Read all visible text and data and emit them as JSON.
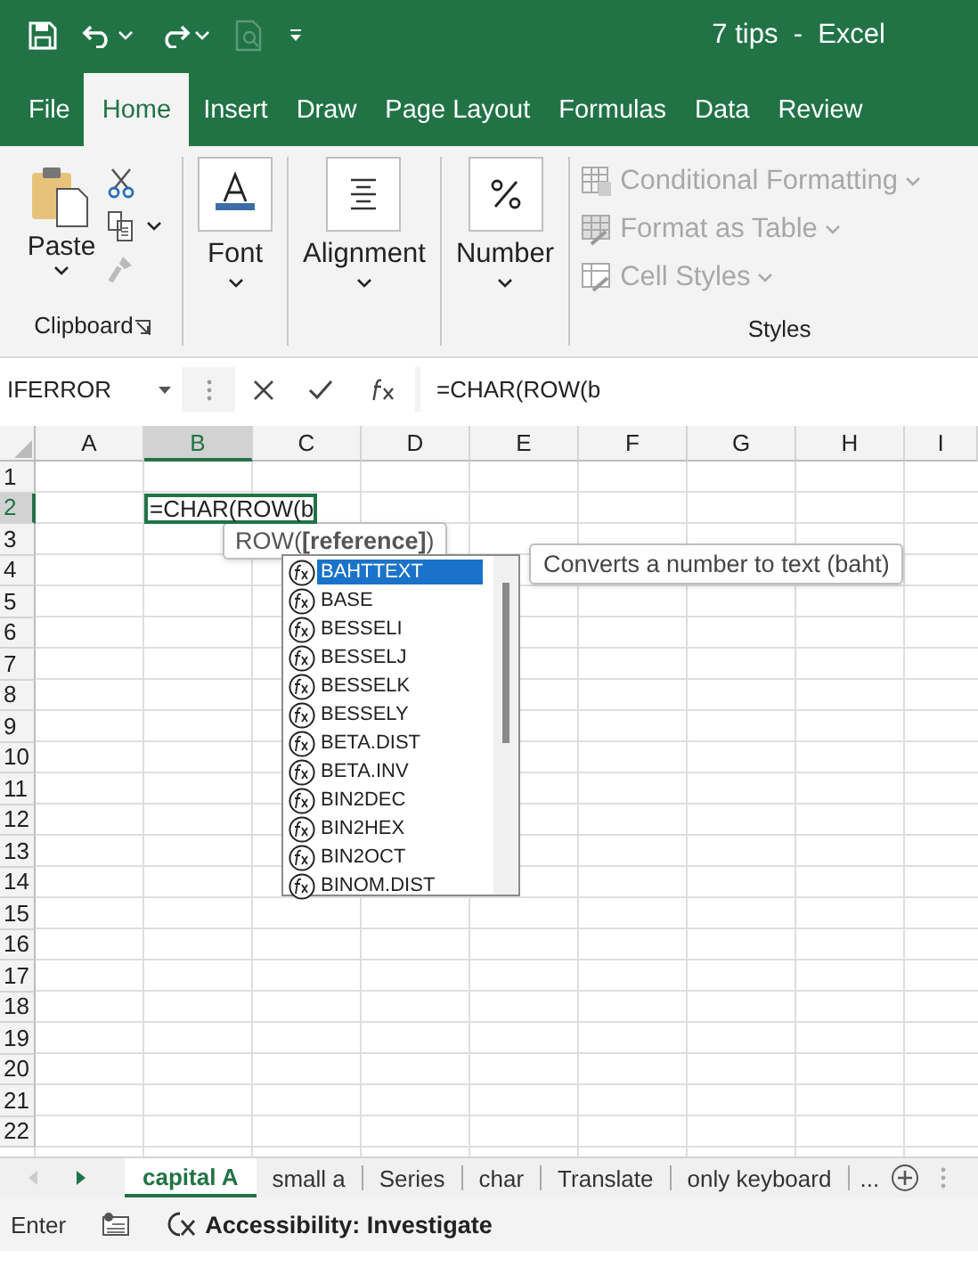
{
  "window": {
    "title": "7 tips  -  Excel"
  },
  "ribbon_tabs": [
    {
      "label": "File",
      "selected": false
    },
    {
      "label": "Home",
      "selected": true
    },
    {
      "label": "Insert",
      "selected": false
    },
    {
      "label": "Draw",
      "selected": false
    },
    {
      "label": "Page Layout",
      "selected": false
    },
    {
      "label": "Formulas",
      "selected": false
    },
    {
      "label": "Data",
      "selected": false
    },
    {
      "label": "Review",
      "selected": false
    }
  ],
  "clipboard": {
    "label": "Clipboard",
    "paste": "Paste"
  },
  "collapsed_groups": [
    {
      "kind": "font",
      "label": "Font"
    },
    {
      "kind": "alignment",
      "label": "Alignment"
    },
    {
      "kind": "number",
      "label": "Number"
    }
  ],
  "styles": {
    "label": "Styles",
    "items": [
      {
        "kind": "conditional",
        "label": "Conditional Formatting",
        "disabled": true
      },
      {
        "kind": "table",
        "label": "Format as Table",
        "disabled": true
      },
      {
        "kind": "cellstyles",
        "label": "Cell Styles",
        "disabled": true
      }
    ]
  },
  "formula_bar": {
    "name_box": "IFERROR",
    "formula": "=CHAR(ROW(b"
  },
  "sheet": {
    "columns": [
      {
        "label": "A",
        "selected": false
      },
      {
        "label": "B",
        "selected": true
      },
      {
        "label": "C",
        "selected": false
      },
      {
        "label": "D",
        "selected": false
      },
      {
        "label": "E",
        "selected": false
      },
      {
        "label": "F",
        "selected": false
      },
      {
        "label": "G",
        "selected": false
      },
      {
        "label": "H",
        "selected": false
      },
      {
        "label": "I",
        "selected": false
      }
    ],
    "rows": [
      {
        "label": "1",
        "selected": false
      },
      {
        "label": "2",
        "selected": true
      },
      {
        "label": "3",
        "selected": false
      },
      {
        "label": "4",
        "selected": false
      },
      {
        "label": "5",
        "selected": false
      },
      {
        "label": "6",
        "selected": false
      },
      {
        "label": "7",
        "selected": false
      },
      {
        "label": "8",
        "selected": false
      },
      {
        "label": "9",
        "selected": false
      },
      {
        "label": "10",
        "selected": false
      },
      {
        "label": "11",
        "selected": false
      },
      {
        "label": "12",
        "selected": false
      },
      {
        "label": "13",
        "selected": false
      },
      {
        "label": "14",
        "selected": false
      },
      {
        "label": "15",
        "selected": false
      },
      {
        "label": "16",
        "selected": false
      },
      {
        "label": "17",
        "selected": false
      },
      {
        "label": "18",
        "selected": false
      },
      {
        "label": "19",
        "selected": false
      },
      {
        "label": "20",
        "selected": false
      },
      {
        "label": "21",
        "selected": false
      },
      {
        "label": "22",
        "selected": false
      }
    ],
    "active_cell": {
      "text": "=CHAR(ROW(b"
    }
  },
  "argument_tip": "ROW(**[reference]**)",
  "autocomplete": {
    "items": [
      {
        "label": "BAHTTEXT",
        "selected": true
      },
      {
        "label": "BASE",
        "selected": false
      },
      {
        "label": "BESSELI",
        "selected": false
      },
      {
        "label": "BESSELJ",
        "selected": false
      },
      {
        "label": "BESSELK",
        "selected": false
      },
      {
        "label": "BESSELY",
        "selected": false
      },
      {
        "label": "BETA.DIST",
        "selected": false
      },
      {
        "label": "BETA.INV",
        "selected": false
      },
      {
        "label": "BIN2DEC",
        "selected": false
      },
      {
        "label": "BIN2HEX",
        "selected": false
      },
      {
        "label": "BIN2OCT",
        "selected": false
      },
      {
        "label": "BINOM.DIST",
        "selected": false
      }
    ],
    "description": "Converts a number to text (baht)"
  },
  "sheet_tabs": [
    {
      "label": "capital A",
      "selected": true
    },
    {
      "label": "small a",
      "selected": false
    },
    {
      "label": "Series",
      "selected": false
    },
    {
      "label": "char",
      "selected": false
    },
    {
      "label": "Translate",
      "selected": false
    },
    {
      "label": "only keyboard",
      "selected": false
    }
  ],
  "sheet_tabs_more": "...",
  "status_bar": {
    "mode": "Enter",
    "accessibility": "Accessibility: Investigate"
  }
}
